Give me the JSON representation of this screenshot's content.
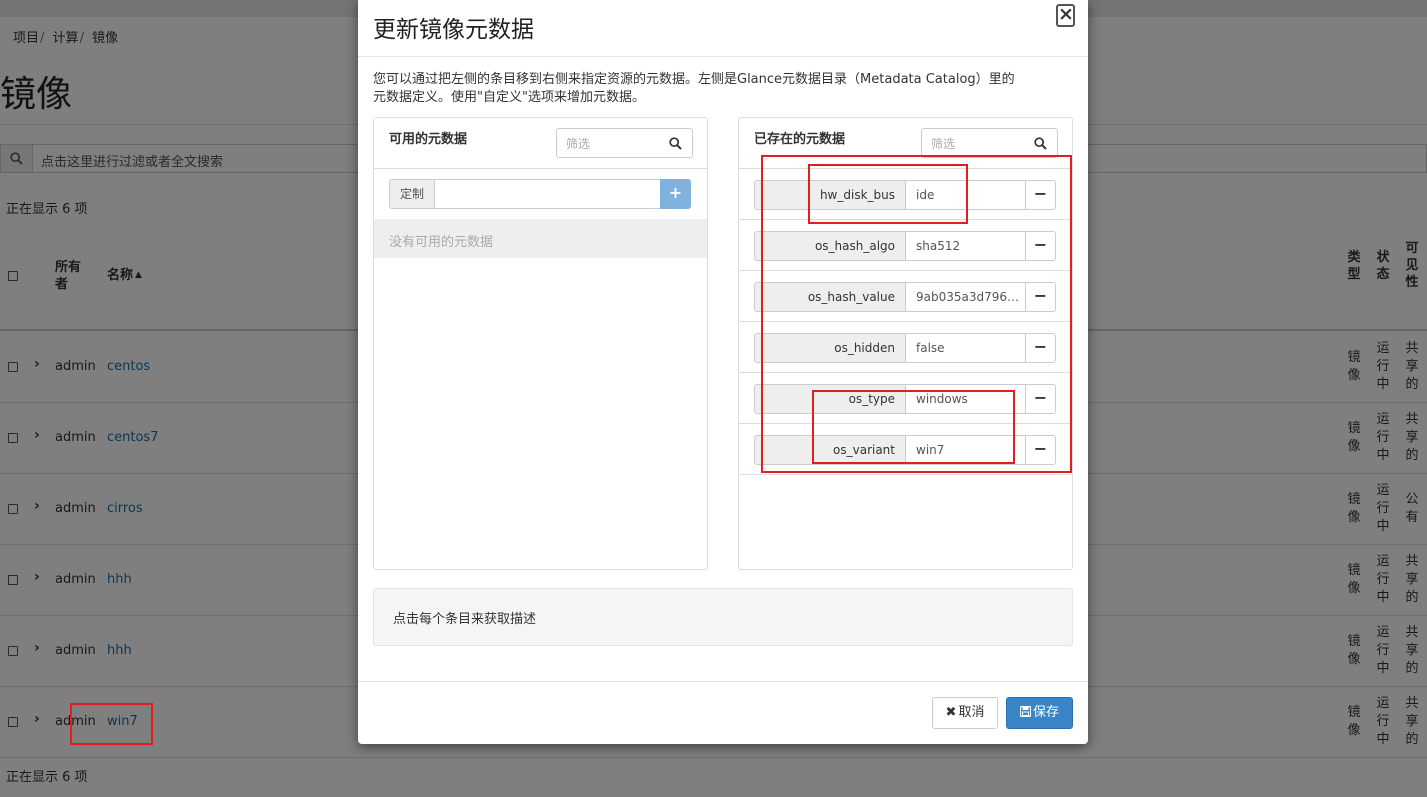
{
  "breadcrumb": [
    "项目",
    "计算",
    "镜像"
  ],
  "page": {
    "title": "镜像",
    "search_placeholder": "点击这里进行过滤或者全文搜索",
    "count_top": "正在显示 6 项",
    "count_bottom": "正在显示 6 项"
  },
  "table": {
    "headers": {
      "owner": "所有者",
      "name": "名称",
      "type": "类型",
      "status": "状态",
      "visibility": "可见性"
    },
    "sort_indicator": "▲",
    "rows": [
      {
        "owner": "admin",
        "name": "centos",
        "type": "镜像",
        "status": "运行中",
        "visibility": "共享的"
      },
      {
        "owner": "admin",
        "name": "centos7",
        "type": "镜像",
        "status": "运行中",
        "visibility": "共享的"
      },
      {
        "owner": "admin",
        "name": "cirros",
        "type": "镜像",
        "status": "运行中",
        "visibility": "公有"
      },
      {
        "owner": "admin",
        "name": "hhh",
        "type": "镜像",
        "status": "运行中",
        "visibility": "共享的"
      },
      {
        "owner": "admin",
        "name": "hhh",
        "type": "镜像",
        "status": "运行中",
        "visibility": "共享的"
      },
      {
        "owner": "admin",
        "name": "win7",
        "type": "镜像",
        "status": "运行中",
        "visibility": "共享的"
      }
    ]
  },
  "modal": {
    "title": "更新镜像元数据",
    "close": "×",
    "description": "您可以通过把左侧的条目移到右侧来指定资源的元数据。左侧是Glance元数据目录（Metadata Catalog）里的元数据定义。使用\"自定义\"选项来增加元数据。",
    "available": {
      "title": "可用的元数据",
      "filter_placeholder": "筛选",
      "custom_label": "定制",
      "add_icon": "+",
      "empty_text": "没有可用的元数据"
    },
    "existing": {
      "title": "已存在的元数据",
      "filter_placeholder": "筛选",
      "items": [
        {
          "key": "hw_disk_bus",
          "value": "ide"
        },
        {
          "key": "os_hash_algo",
          "value": "sha512"
        },
        {
          "key": "os_hash_value",
          "value": "9ab035a3d7960..."
        },
        {
          "key": "os_hidden",
          "value": "false"
        },
        {
          "key": "os_type",
          "value": "windows"
        },
        {
          "key": "os_variant",
          "value": "win7"
        }
      ],
      "remove_icon": "−"
    },
    "help_text": "点击每个条目来获取描述",
    "cancel_label": "取消",
    "save_label": "保存"
  },
  "colors": {
    "accent": "#3a85c8",
    "link": "#1a6ea8",
    "highlight": "#e02020"
  }
}
